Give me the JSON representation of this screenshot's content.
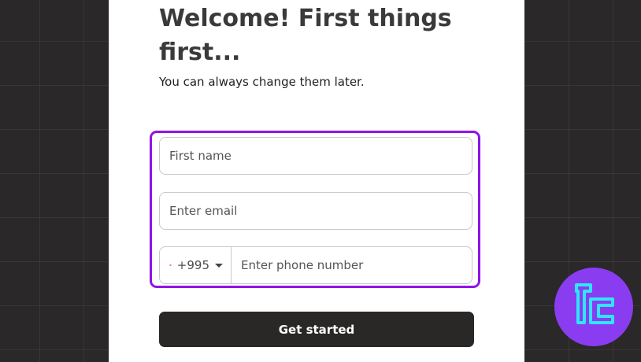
{
  "card": {
    "heading": "Welcome! First things first...",
    "subtitle": "You can always change them later."
  },
  "form": {
    "first_name_placeholder": "First name",
    "email_placeholder": "Enter email",
    "phone": {
      "country_flag": "georgia-flag-icon",
      "country_code": "+995",
      "placeholder": "Enter phone number"
    },
    "submit_label": "Get started"
  },
  "colors": {
    "highlight_border": "#9013e6",
    "cta_background": "#2a2727",
    "page_background": "#2a2828",
    "logo_purple": "#8a3cf0",
    "logo_cyan": "#2ee6ff"
  }
}
